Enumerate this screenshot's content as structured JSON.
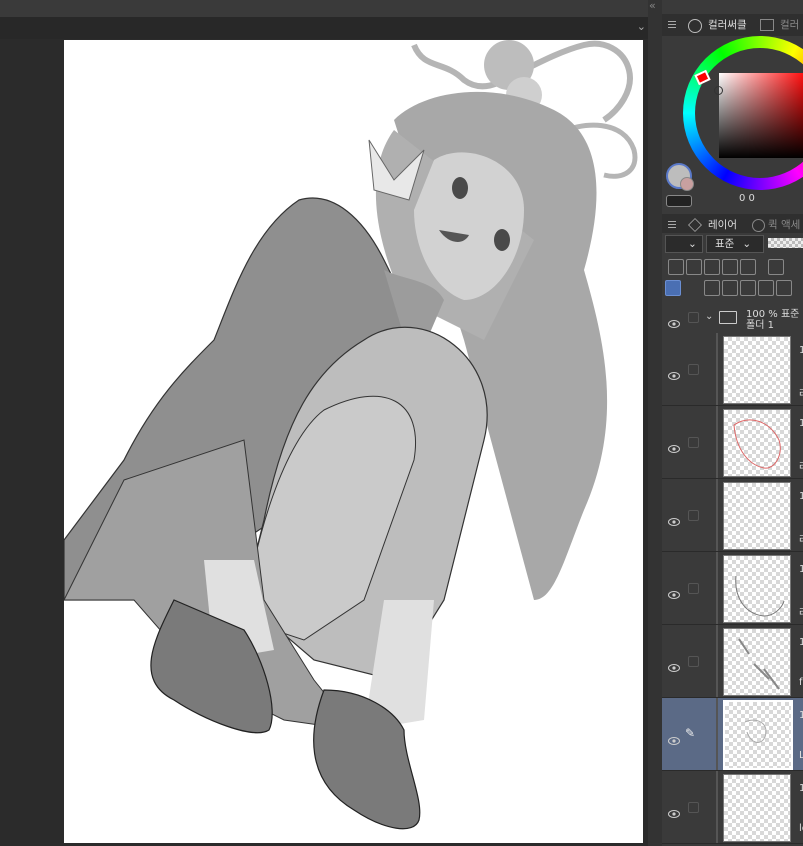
{
  "panel": {
    "color_tab_label": "컬러써클",
    "color_tab2_label": "컬러",
    "layer_tab_label": "레이어",
    "layer_tab2_label": "퀵 액세",
    "blend_mode": "표준",
    "color_values": "0  0",
    "folder": {
      "opacity": "100 % 표준",
      "name": "폴더 1"
    },
    "layers": [
      {
        "label": "1",
        "sub": "라"
      },
      {
        "label": "1",
        "sub": "라"
      },
      {
        "label": "1",
        "sub": "라"
      },
      {
        "label": "1",
        "sub": "라"
      },
      {
        "label": "1",
        "sub": "fa"
      },
      {
        "label": "1",
        "sub": "L"
      },
      {
        "label": "1",
        "sub": "lo"
      }
    ]
  },
  "colors": {
    "accent": "#4a6fb3",
    "selected_layer": "#5b6a86",
    "main_color": "#bdbdbd"
  },
  "icons": [
    "collapse-panel-icon",
    "menu-icon",
    "color-wheel-icon",
    "layers-icon",
    "quick-access-icon",
    "folder-icon",
    "eye-icon",
    "pen-icon",
    "lock-icon",
    "new-layer-icon"
  ]
}
